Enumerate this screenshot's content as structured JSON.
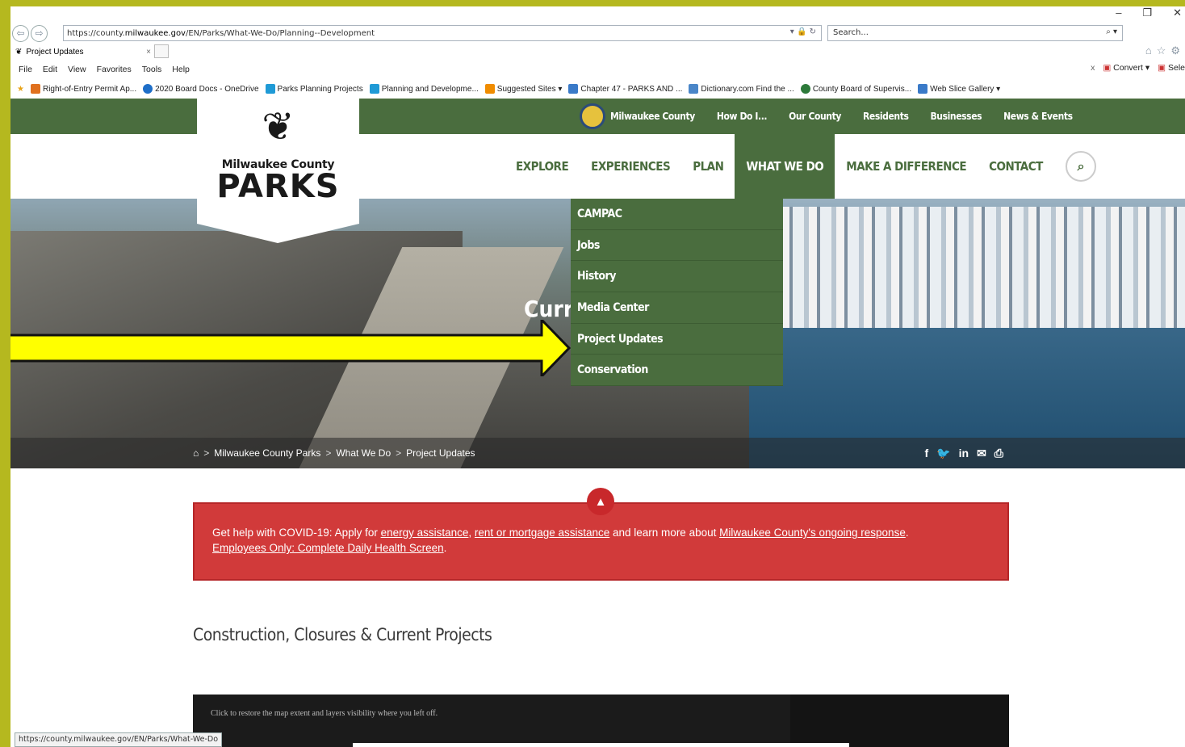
{
  "browser": {
    "url_prefix": "https://county.",
    "url_host": "milwaukee.gov",
    "url_path": "/EN/Parks/What-We-Do/Planning--Development",
    "search_placeholder": "Search...",
    "tab_title": "Project Updates",
    "menu": [
      "File",
      "Edit",
      "View",
      "Favorites",
      "Tools",
      "Help"
    ],
    "menu_right": [
      "Convert",
      "Sele"
    ],
    "favorites": [
      {
        "label": "Right-of-Entry Permit Ap...",
        "color": "#e0701e"
      },
      {
        "label": "2020 Board Docs - OneDrive",
        "color": "#1e6ec8"
      },
      {
        "label": "Parks Planning Projects",
        "color": "#1f9ad6"
      },
      {
        "label": "Planning and Developme...",
        "color": "#1f9ad6"
      },
      {
        "label": "Suggested Sites ▾",
        "color": "#f08c00"
      },
      {
        "label": "Chapter 47 - PARKS AND ...",
        "color": "#3a7ac8"
      },
      {
        "label": "Dictionary.com  Find the ...",
        "color": "#4a86c8"
      },
      {
        "label": "County Board of Supervis...",
        "color": "#2d7a3a"
      },
      {
        "label": "Web Slice Gallery ▾",
        "color": "#3a7ac8"
      }
    ],
    "status_url": "https://county.milwaukee.gov/EN/Parks/What-We-Do"
  },
  "site": {
    "logo_line1": "Milwaukee County",
    "logo_line2": "PARKS",
    "top_nav": [
      "Milwaukee County",
      "How Do I...",
      "Our County",
      "Residents",
      "Businesses",
      "News & Events"
    ],
    "main_nav": [
      "EXPLORE",
      "EXPERIENCES",
      "PLAN",
      "WHAT WE DO",
      "MAKE A DIFFERENCE",
      "CONTACT"
    ],
    "dropdown": [
      "CAMPAC",
      "Jobs",
      "History",
      "Media Center",
      "Project Updates",
      "Conservation"
    ],
    "hero_title": "Curre",
    "breadcrumb": [
      "Milwaukee County Parks",
      "What We Do",
      "Project Updates"
    ],
    "share": [
      "f",
      "y",
      "in",
      "✉",
      "⎙"
    ]
  },
  "alert": {
    "prefix": "Get help with COVID-19: Apply for ",
    "link1": "energy assistance",
    "sep1": ", ",
    "link2": "rent or mortgage assistance",
    "mid": " and learn more about ",
    "link3": "Milwaukee County's ongoing response",
    "end": ".",
    "link4": "Employees Only: Complete Daily Health Screen",
    "end2": "."
  },
  "section_title": "Construction, Closures & Current Projects",
  "map": {
    "hint": "Click to restore the map extent and layers visibility where you left off."
  },
  "colors": {
    "green": "#4a6d3e",
    "alert_red": "#d13a3a",
    "arrow_yellow": "#ffff00"
  }
}
